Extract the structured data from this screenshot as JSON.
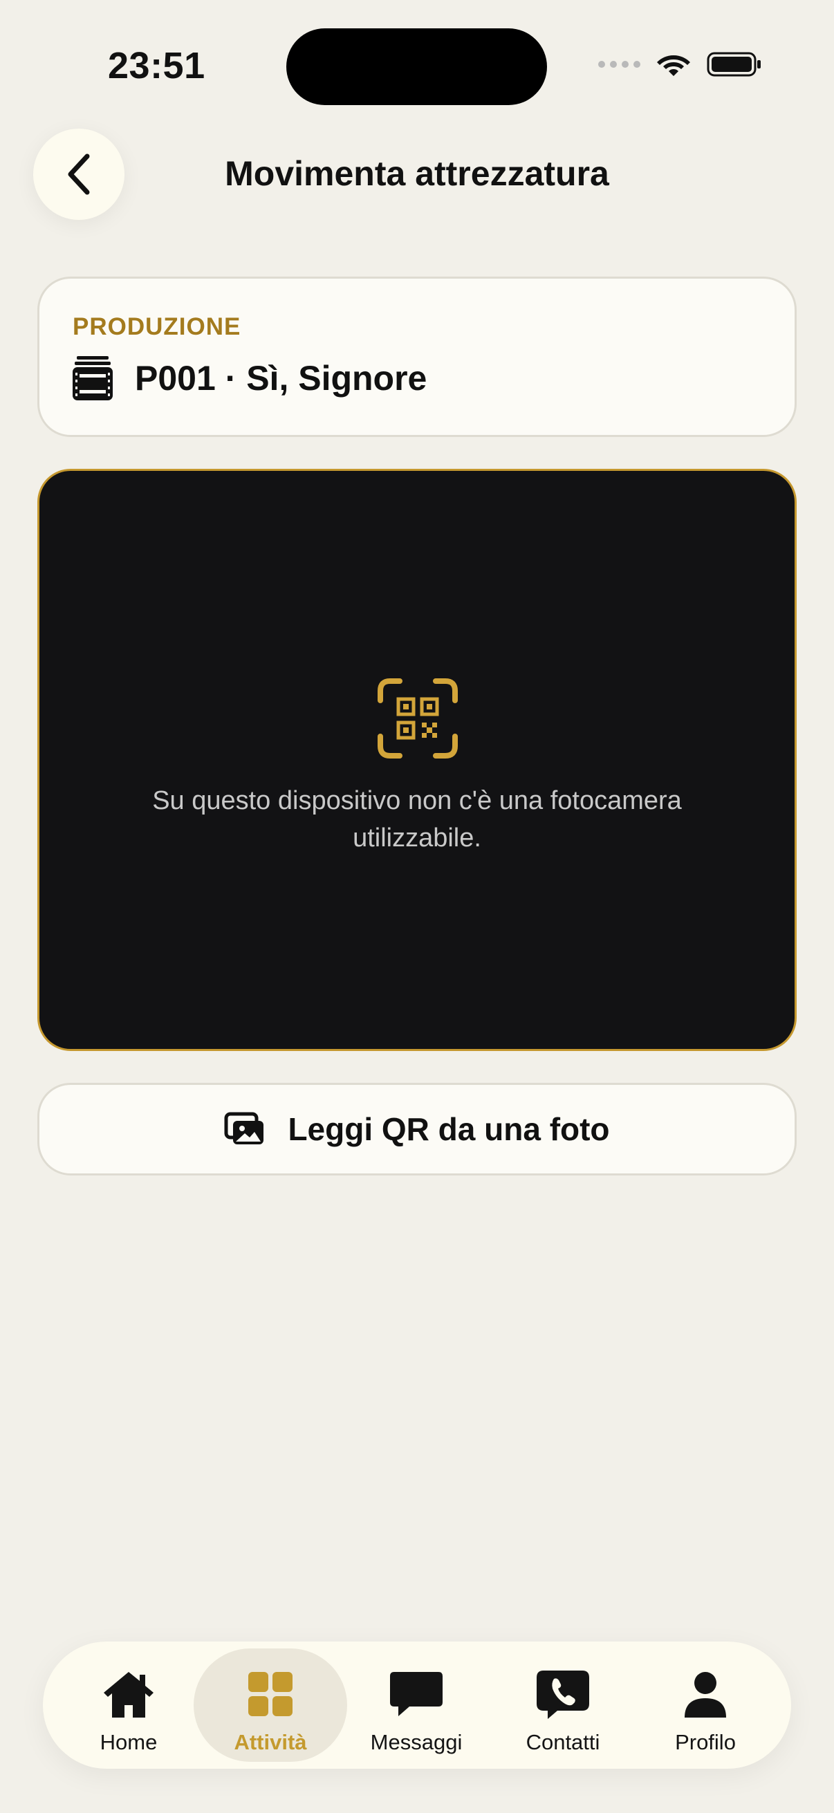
{
  "status": {
    "time": "23:51"
  },
  "header": {
    "title": "Movimenta attrezzatura",
    "back_icon": "chevron-left-icon"
  },
  "production": {
    "label": "PRODUZIONE",
    "name": "P001 · Sì, Signore",
    "icon": "film-icon"
  },
  "scanner": {
    "icon": "qr-scan-icon",
    "message": "Su questo dispositivo non c'è una fotocamera utilizzabile."
  },
  "photo_button": {
    "label": "Leggi QR da una foto",
    "icon": "photo-gallery-icon"
  },
  "tabbar": {
    "items": [
      {
        "label": "Home",
        "icon": "home-icon"
      },
      {
        "label": "Attività",
        "icon": "grid-icon",
        "active": true
      },
      {
        "label": "Messaggi",
        "icon": "chat-bubble-icon"
      },
      {
        "label": "Contatti",
        "icon": "phone-icon"
      },
      {
        "label": "Profilo",
        "icon": "person-icon"
      }
    ]
  },
  "colors": {
    "accent": "#c49a2e",
    "background": "#f2f0e9",
    "scanner_bg": "#121214",
    "label_gold": "#a47b1e"
  }
}
